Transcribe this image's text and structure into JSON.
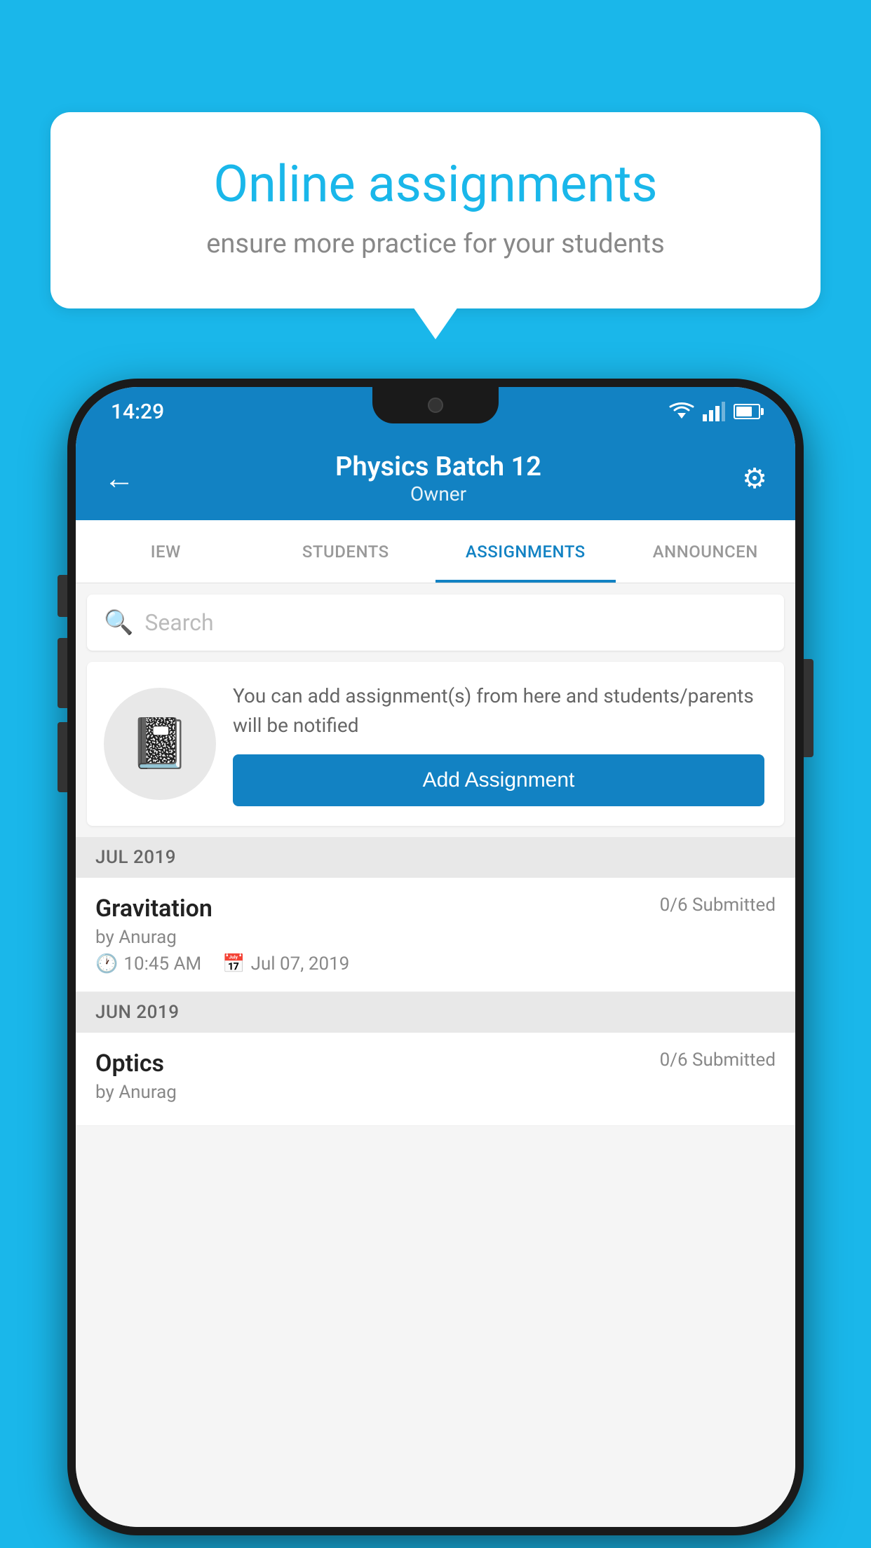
{
  "background_color": "#1ab7ea",
  "bubble": {
    "title": "Online assignments",
    "subtitle": "ensure more practice for your students"
  },
  "status_bar": {
    "time": "14:29"
  },
  "app_bar": {
    "title": "Physics Batch 12",
    "subtitle": "Owner"
  },
  "tabs": [
    {
      "id": "overview",
      "label": "IEW"
    },
    {
      "id": "students",
      "label": "STUDENTS"
    },
    {
      "id": "assignments",
      "label": "ASSIGNMENTS",
      "active": true
    },
    {
      "id": "announcements",
      "label": "ANNOUNCEN"
    }
  ],
  "search": {
    "placeholder": "Search"
  },
  "promo": {
    "text": "You can add assignment(s) from here and students/parents will be notified",
    "button_label": "Add Assignment"
  },
  "sections": [
    {
      "label": "JUL 2019",
      "assignments": [
        {
          "name": "Gravitation",
          "submitted": "0/6 Submitted",
          "author": "by Anurag",
          "time": "10:45 AM",
          "date": "Jul 07, 2019"
        }
      ]
    },
    {
      "label": "JUN 2019",
      "assignments": [
        {
          "name": "Optics",
          "submitted": "0/6 Submitted",
          "author": "by Anurag",
          "time": "",
          "date": ""
        }
      ]
    }
  ]
}
